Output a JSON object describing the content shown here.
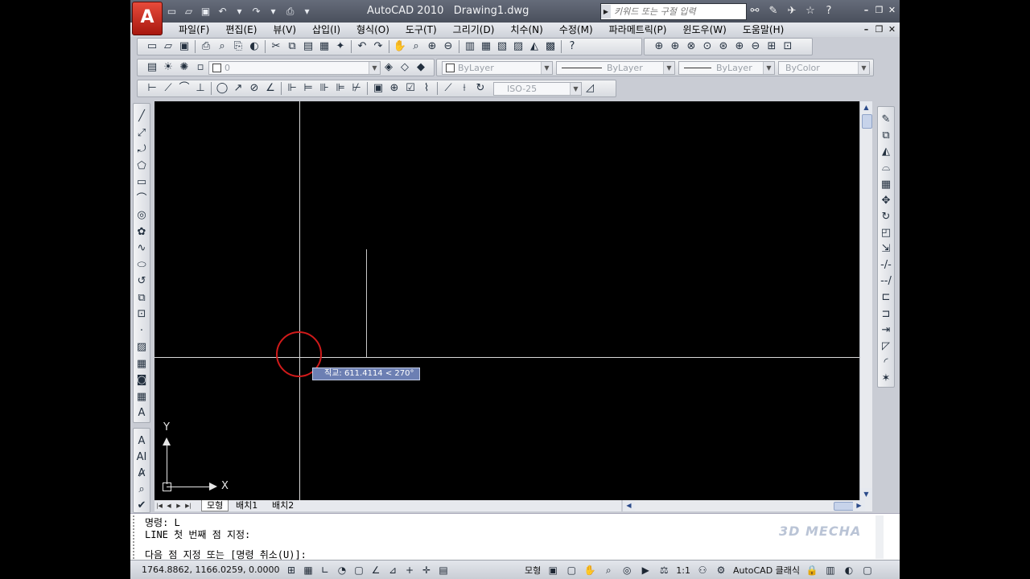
{
  "app": {
    "logo_letter": "A",
    "title": "AutoCAD 2010   Drawing1.dwg"
  },
  "title_bar": {
    "quick_access_icons": [
      "new-icon",
      "open-icon",
      "save-icon",
      "undo-icon",
      "redo-icon",
      "plot-icon"
    ],
    "search_placeholder": "키워드 또는 구절 입력",
    "info_icons": [
      "binoculars-icon",
      "wrench-icon",
      "satellite-icon",
      "star-icon",
      "help-icon"
    ],
    "window_controls": [
      "minimize",
      "restore",
      "close"
    ]
  },
  "menu": {
    "items": [
      "파일(F)",
      "편집(E)",
      "뷰(V)",
      "삽입(I)",
      "형식(O)",
      "도구(T)",
      "그리기(D)",
      "치수(N)",
      "수정(M)",
      "파라메트릭(P)",
      "윈도우(W)",
      "도움말(H)"
    ]
  },
  "layer_toolbar": {
    "layer_value": "0",
    "color_value": "ByLayer",
    "linetype_value": "ByLayer",
    "lineweight_value": "ByLayer",
    "plotstyle_value": "ByColor"
  },
  "dimension_toolbar": {
    "dimstyle_value": "ISO-25"
  },
  "canvas": {
    "background": "#000000",
    "tooltip_text": "직교: 611.4114 < 270°",
    "ucs_x_label": "X",
    "ucs_y_label": "Y",
    "highlight_color": "#d01a1a"
  },
  "layout_tabs": [
    "모형",
    "배치1",
    "배치2"
  ],
  "command_window": {
    "line1": "명령: L",
    "line2": "LINE 첫 번째 점 지정:",
    "line3": "다음 점 지정 또는 [명령 취소(U)]:",
    "watermark": "3D MECHA"
  },
  "status_bar": {
    "coordinates": "1764.8862, 1166.0259, 0.0000",
    "model_label": "모형",
    "annotation_scale": "1:1",
    "workspace": "AutoCAD 클래식"
  }
}
